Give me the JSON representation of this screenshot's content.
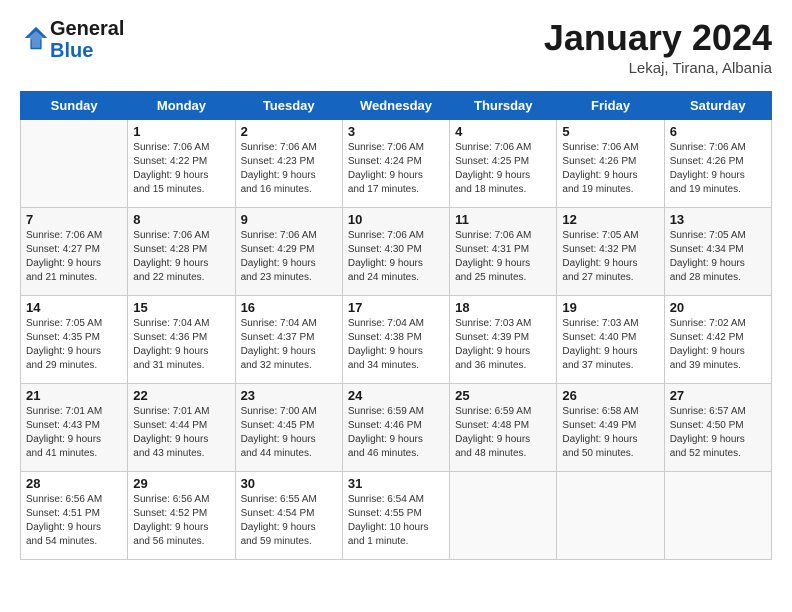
{
  "logo": {
    "general": "General",
    "blue": "Blue"
  },
  "header": {
    "title": "January 2024",
    "subtitle": "Lekaj, Tirana, Albania"
  },
  "days": [
    "Sunday",
    "Monday",
    "Tuesday",
    "Wednesday",
    "Thursday",
    "Friday",
    "Saturday"
  ],
  "weeks": [
    [
      {
        "day": "",
        "info": ""
      },
      {
        "day": "1",
        "info": "Sunrise: 7:06 AM\nSunset: 4:22 PM\nDaylight: 9 hours\nand 15 minutes."
      },
      {
        "day": "2",
        "info": "Sunrise: 7:06 AM\nSunset: 4:23 PM\nDaylight: 9 hours\nand 16 minutes."
      },
      {
        "day": "3",
        "info": "Sunrise: 7:06 AM\nSunset: 4:24 PM\nDaylight: 9 hours\nand 17 minutes."
      },
      {
        "day": "4",
        "info": "Sunrise: 7:06 AM\nSunset: 4:25 PM\nDaylight: 9 hours\nand 18 minutes."
      },
      {
        "day": "5",
        "info": "Sunrise: 7:06 AM\nSunset: 4:26 PM\nDaylight: 9 hours\nand 19 minutes."
      },
      {
        "day": "6",
        "info": "Sunrise: 7:06 AM\nSunset: 4:26 PM\nDaylight: 9 hours\nand 19 minutes."
      }
    ],
    [
      {
        "day": "7",
        "info": "Sunrise: 7:06 AM\nSunset: 4:27 PM\nDaylight: 9 hours\nand 21 minutes."
      },
      {
        "day": "8",
        "info": "Sunrise: 7:06 AM\nSunset: 4:28 PM\nDaylight: 9 hours\nand 22 minutes."
      },
      {
        "day": "9",
        "info": "Sunrise: 7:06 AM\nSunset: 4:29 PM\nDaylight: 9 hours\nand 23 minutes."
      },
      {
        "day": "10",
        "info": "Sunrise: 7:06 AM\nSunset: 4:30 PM\nDaylight: 9 hours\nand 24 minutes."
      },
      {
        "day": "11",
        "info": "Sunrise: 7:06 AM\nSunset: 4:31 PM\nDaylight: 9 hours\nand 25 minutes."
      },
      {
        "day": "12",
        "info": "Sunrise: 7:05 AM\nSunset: 4:32 PM\nDaylight: 9 hours\nand 27 minutes."
      },
      {
        "day": "13",
        "info": "Sunrise: 7:05 AM\nSunset: 4:34 PM\nDaylight: 9 hours\nand 28 minutes."
      }
    ],
    [
      {
        "day": "14",
        "info": "Sunrise: 7:05 AM\nSunset: 4:35 PM\nDaylight: 9 hours\nand 29 minutes."
      },
      {
        "day": "15",
        "info": "Sunrise: 7:04 AM\nSunset: 4:36 PM\nDaylight: 9 hours\nand 31 minutes."
      },
      {
        "day": "16",
        "info": "Sunrise: 7:04 AM\nSunset: 4:37 PM\nDaylight: 9 hours\nand 32 minutes."
      },
      {
        "day": "17",
        "info": "Sunrise: 7:04 AM\nSunset: 4:38 PM\nDaylight: 9 hours\nand 34 minutes."
      },
      {
        "day": "18",
        "info": "Sunrise: 7:03 AM\nSunset: 4:39 PM\nDaylight: 9 hours\nand 36 minutes."
      },
      {
        "day": "19",
        "info": "Sunrise: 7:03 AM\nSunset: 4:40 PM\nDaylight: 9 hours\nand 37 minutes."
      },
      {
        "day": "20",
        "info": "Sunrise: 7:02 AM\nSunset: 4:42 PM\nDaylight: 9 hours\nand 39 minutes."
      }
    ],
    [
      {
        "day": "21",
        "info": "Sunrise: 7:01 AM\nSunset: 4:43 PM\nDaylight: 9 hours\nand 41 minutes."
      },
      {
        "day": "22",
        "info": "Sunrise: 7:01 AM\nSunset: 4:44 PM\nDaylight: 9 hours\nand 43 minutes."
      },
      {
        "day": "23",
        "info": "Sunrise: 7:00 AM\nSunset: 4:45 PM\nDaylight: 9 hours\nand 44 minutes."
      },
      {
        "day": "24",
        "info": "Sunrise: 6:59 AM\nSunset: 4:46 PM\nDaylight: 9 hours\nand 46 minutes."
      },
      {
        "day": "25",
        "info": "Sunrise: 6:59 AM\nSunset: 4:48 PM\nDaylight: 9 hours\nand 48 minutes."
      },
      {
        "day": "26",
        "info": "Sunrise: 6:58 AM\nSunset: 4:49 PM\nDaylight: 9 hours\nand 50 minutes."
      },
      {
        "day": "27",
        "info": "Sunrise: 6:57 AM\nSunset: 4:50 PM\nDaylight: 9 hours\nand 52 minutes."
      }
    ],
    [
      {
        "day": "28",
        "info": "Sunrise: 6:56 AM\nSunset: 4:51 PM\nDaylight: 9 hours\nand 54 minutes."
      },
      {
        "day": "29",
        "info": "Sunrise: 6:56 AM\nSunset: 4:52 PM\nDaylight: 9 hours\nand 56 minutes."
      },
      {
        "day": "30",
        "info": "Sunrise: 6:55 AM\nSunset: 4:54 PM\nDaylight: 9 hours\nand 59 minutes."
      },
      {
        "day": "31",
        "info": "Sunrise: 6:54 AM\nSunset: 4:55 PM\nDaylight: 10 hours\nand 1 minute."
      },
      {
        "day": "",
        "info": ""
      },
      {
        "day": "",
        "info": ""
      },
      {
        "day": "",
        "info": ""
      }
    ]
  ]
}
